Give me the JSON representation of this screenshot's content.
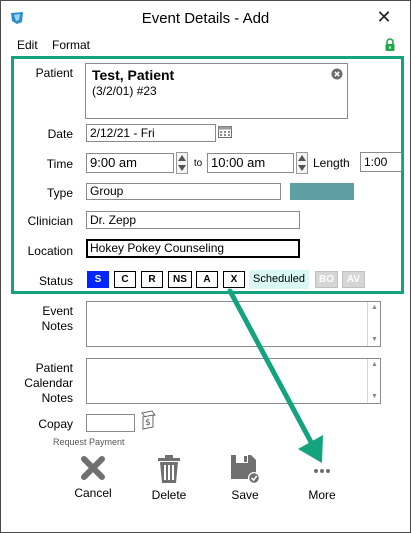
{
  "window": {
    "title": "Event Details - Add",
    "close_glyph": "✕"
  },
  "menu": {
    "items": [
      "Edit",
      "Format"
    ]
  },
  "form": {
    "patient_label": "Patient",
    "patient_name": "Test, Patient",
    "patient_details": "(3/2/01) #23",
    "date_label": "Date",
    "date_value": "2/12/21 - Fri",
    "time_label": "Time",
    "time_start": "9:00 am",
    "time_to": "to",
    "time_end": "10:00 am",
    "length_label": "Length",
    "length_value": "1:00",
    "type_label": "Type",
    "type_value": "Group",
    "type_color": "#5e9fa3",
    "clinician_label": "Clinician",
    "clinician_value": "Dr. Zepp",
    "location_label": "Location",
    "location_value": "Hokey Pokey Counseling",
    "status_label": "Status",
    "status_buttons": [
      "S",
      "C",
      "R",
      "NS",
      "A",
      "X"
    ],
    "status_selected": "S",
    "status_text": "Scheduled",
    "status_extra_buttons": [
      "BO",
      "AV"
    ],
    "event_notes_label_1": "Event",
    "event_notes_label_2": "Notes",
    "calendar_notes_label_1": "Patient",
    "calendar_notes_label_2": "Calendar",
    "calendar_notes_label_3": "Notes",
    "copay_label": "Copay",
    "copay_value": "",
    "request_payment_label": "Request Payment"
  },
  "actions": {
    "cancel": "Cancel",
    "delete": "Delete",
    "save": "Save",
    "more": "More"
  },
  "colors": {
    "accent_green": "#14a37f",
    "status_active": "#0026ff",
    "status_pill_bg": "#d9f7f4"
  },
  "icons": {
    "app": "app-logo-icon",
    "lock": "lock-icon",
    "clear": "clear-circle-x-icon",
    "calendar": "calendar-icon",
    "payment": "payment-card-icon",
    "cancel": "x-icon",
    "delete": "trash-icon",
    "save": "floppy-check-icon",
    "more": "ellipsis-icon"
  }
}
